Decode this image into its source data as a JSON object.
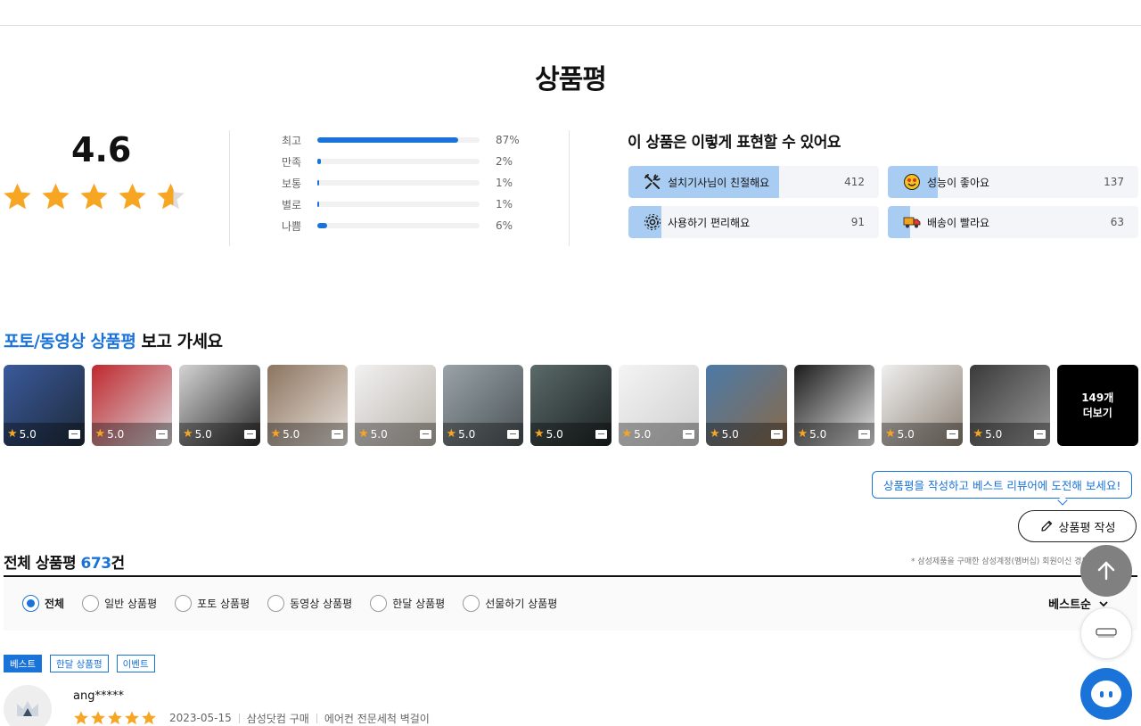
{
  "title": "상품평",
  "summary": {
    "score": "4.6",
    "rating_value": 4.6,
    "distribution": [
      {
        "label": "최고",
        "percent_text": "87%",
        "percent": 87
      },
      {
        "label": "만족",
        "percent_text": "2%",
        "percent": 2
      },
      {
        "label": "보통",
        "percent_text": "1%",
        "percent": 1
      },
      {
        "label": "별로",
        "percent_text": "1%",
        "percent": 1
      },
      {
        "label": "나쁨",
        "percent_text": "6%",
        "percent": 6
      }
    ]
  },
  "expressions": {
    "title": "이 상품은 이렇게 표현할 수 있어요",
    "items": [
      {
        "icon": "tools-icon",
        "label": "설치기사님이 친절해요",
        "count": "412",
        "share": 0.6
      },
      {
        "icon": "smiling-face-icon",
        "label": "성능이 좋아요",
        "count": "137",
        "share": 0.2
      },
      {
        "icon": "gear-icon",
        "label": "사용하기 편리해요",
        "count": "91",
        "share": 0.13
      },
      {
        "icon": "delivery-truck-icon",
        "label": "배송이 빨라요",
        "count": "63",
        "share": 0.09
      }
    ]
  },
  "photos": {
    "title_highlight": "포토/동영상 상품평",
    "title_rest": " 보고 가세요",
    "items": [
      {
        "rating": "5.0",
        "colors": [
          "#3a5a9c",
          "#1e2a3a"
        ]
      },
      {
        "rating": "5.0",
        "colors": [
          "#c0282e",
          "#d8d8dc"
        ]
      },
      {
        "rating": "5.0",
        "colors": [
          "#d4d4d4",
          "#2a2a2a"
        ]
      },
      {
        "rating": "5.0",
        "colors": [
          "#8c7460",
          "#e9e3dc"
        ]
      },
      {
        "rating": "5.0",
        "colors": [
          "#f2f2f2",
          "#b9b2aa"
        ]
      },
      {
        "rating": "5.0",
        "colors": [
          "#9aa4a8",
          "#4a5256"
        ]
      },
      {
        "rating": "5.0",
        "colors": [
          "#5b6a6a",
          "#1c2222"
        ]
      },
      {
        "rating": "5.0",
        "colors": [
          "#f4f4f4",
          "#cfcfcf"
        ]
      },
      {
        "rating": "5.0",
        "colors": [
          "#4b7aa8",
          "#8a6a4a"
        ]
      },
      {
        "rating": "5.0",
        "colors": [
          "#1b1b1b",
          "#e8e8e8"
        ]
      },
      {
        "rating": "5.0",
        "colors": [
          "#efefef",
          "#8e8276"
        ]
      },
      {
        "rating": "5.0",
        "colors": [
          "#3a3a3a",
          "#9a9a9a"
        ]
      }
    ],
    "more_count": "149개",
    "more_label": "더보기"
  },
  "promo": "상품평을 작성하고 베스트 리뷰어에 도전해 보세요!",
  "write_button": "상품평 작성",
  "list": {
    "title": "전체 상품평",
    "count": "673",
    "count_suffix": "건",
    "note": "* 삼성제품을 구매한 삼성계정(멤버십) 회원이신 경우 작성 가능",
    "filters": [
      "전체",
      "일반 상품평",
      "포토 상품평",
      "동영상 상품평",
      "한달 상품평",
      "선물하기 상품평"
    ],
    "selected_filter": "전체",
    "sort": "베스트순"
  },
  "review": {
    "tags": [
      "베스트",
      "한달 상품평",
      "이벤트"
    ],
    "user": "ang*****",
    "rating": 5,
    "date": "2023-05-15",
    "purchase": "삼성닷컴 구매",
    "product": "에어컨 전문세척 벽걸이"
  },
  "colors": {
    "accent": "#1a73d9",
    "star": "#f6a623"
  }
}
